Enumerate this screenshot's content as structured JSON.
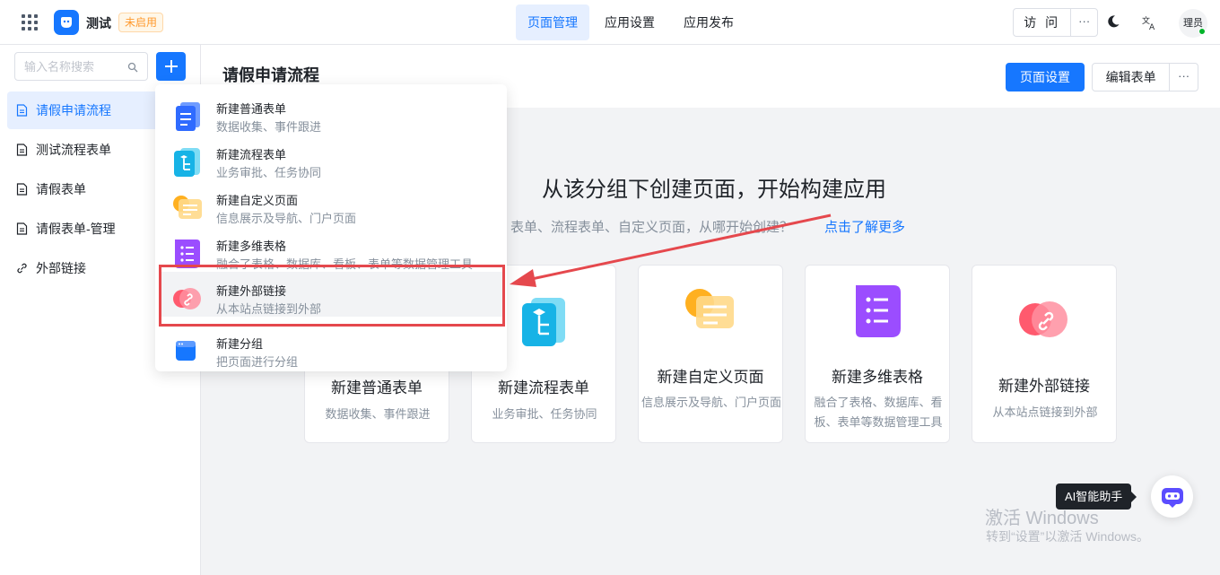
{
  "topbar": {
    "app_name": "测试",
    "status": "未启用",
    "tabs": [
      {
        "label": "页面管理",
        "active": true
      },
      {
        "label": "应用设置",
        "active": false
      },
      {
        "label": "应用发布",
        "active": false
      }
    ],
    "visit_label": "访 问",
    "more_label": "···",
    "avatar_text": "理员"
  },
  "sidebar": {
    "search_placeholder": "输入名称搜索",
    "items": [
      {
        "label": "请假申请流程",
        "icon": "document-icon",
        "active": true
      },
      {
        "label": "测试流程表单",
        "icon": "document-icon",
        "active": false
      },
      {
        "label": "请假表单",
        "icon": "document-icon",
        "active": false
      },
      {
        "label": "请假表单-管理",
        "icon": "document-icon",
        "active": false
      },
      {
        "label": "外部链接",
        "icon": "link-icon",
        "active": false
      }
    ]
  },
  "main": {
    "title": "请假申请流程",
    "page_settings": "页面设置",
    "edit_form": "编辑表单",
    "more_label": "···",
    "empty_title": "从该分组下创建页面，开始构建应用",
    "empty_subtitle": "表单、流程表单、自定义页面，从哪开始创建？",
    "learn_more": "点击了解更多",
    "cards": [
      {
        "title": "新建普通表单",
        "desc": "数据收集、事件跟进"
      },
      {
        "title": "新建流程表单",
        "desc": "业务审批、任务协同"
      },
      {
        "title": "新建自定义页面",
        "desc": "信息展示及导航、门户页面"
      },
      {
        "title": "新建多维表格",
        "desc": "融合了表格、数据库、看板、表单等数据管理工具"
      },
      {
        "title": "新建外部链接",
        "desc": "从本站点链接到外部"
      }
    ]
  },
  "menu": {
    "items": [
      {
        "title": "新建普通表单",
        "desc": "数据收集、事件跟进"
      },
      {
        "title": "新建流程表单",
        "desc": "业务审批、任务协同"
      },
      {
        "title": "新建自定义页面",
        "desc": "信息展示及导航、门户页面"
      },
      {
        "title": "新建多维表格",
        "desc": "融合了表格、数据库、看板、表单等数据管理工具"
      },
      {
        "title": "新建外部链接",
        "desc": "从本站点链接到外部"
      },
      {
        "title": "新建分组",
        "desc": "把页面进行分组"
      }
    ]
  },
  "assistant": {
    "tooltip": "AI智能助手"
  },
  "watermark": {
    "line1": "激活 Windows",
    "line2": "转到“设置”以激活 Windows。"
  },
  "colors": {
    "primary": "#1677ff",
    "highlight": "#e5484d",
    "status_tag": "#ff9a2e"
  }
}
